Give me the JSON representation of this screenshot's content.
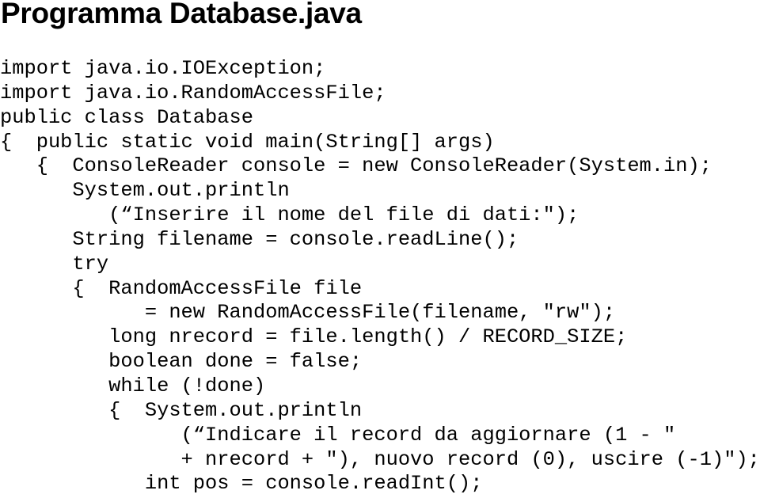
{
  "title": "Programma Database.java",
  "code_lines": [
    "import java.io.IOException;",
    "import java.io.RandomAccessFile;",
    "public class Database",
    "{  public static void main(String[] args)",
    "   {  ConsoleReader console = new ConsoleReader(System.in);",
    "      System.out.println",
    "         (“Inserire il nome del file di dati:\");",
    "      String filename = console.readLine();",
    "      try",
    "      {  RandomAccessFile file",
    "            = new RandomAccessFile(filename, \"rw\");",
    "         long nrecord = file.length() / RECORD_SIZE;",
    "         boolean done = false;",
    "         while (!done)",
    "         {  System.out.println",
    "               (“Indicare il record da aggiornare (1 - \"",
    "               + nrecord + \"), nuovo record (0), uscire (-1)\");",
    "            int pos = console.readInt();"
  ]
}
